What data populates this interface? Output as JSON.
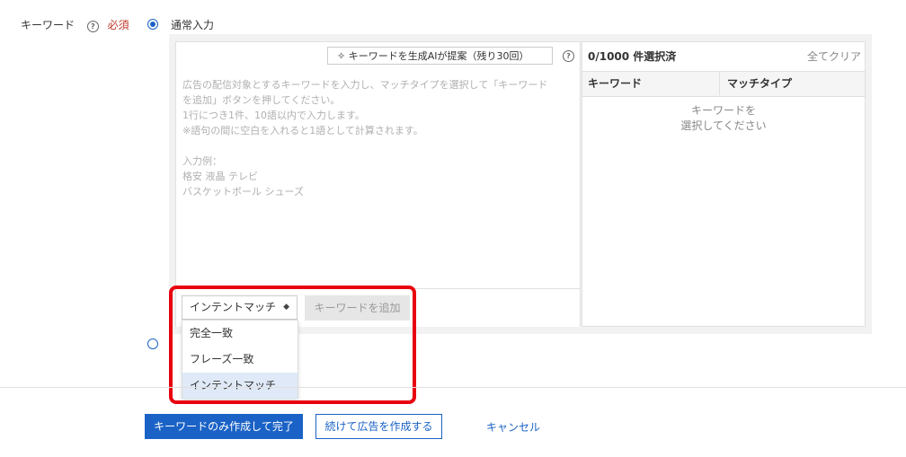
{
  "field": {
    "label": "キーワード",
    "help_glyph": "?",
    "required": "必須"
  },
  "mode": {
    "normal_label": "通常入力",
    "selected": "normal"
  },
  "input_panel": {
    "ai_button_label": "✧ キーワードを生成AIが提案（残り30回）",
    "help_glyph": "?",
    "placeholder": "広告の配信対象とするキーワードを入力し、マッチタイプを選択して「キーワード\nを追加」ボタンを押してください。\n1行につき1件、10語以内で入力します。\n※語句の間に空白を入れると1語として計算されます。\n\n入力例：\n格安 液晶 テレビ\nバスケットボール シューズ",
    "match_type_selected": "インテントマッチ",
    "select_arrow": "◆",
    "add_button_label": "キーワードを追加",
    "dropdown_options": [
      "完全一致",
      "フレーズ一致",
      "インテントマッチ"
    ],
    "dropdown_selected_index": 2
  },
  "selected_panel": {
    "count_text": "0/1000 件選択済",
    "clear_all_label": "全てクリア",
    "columns": [
      "キーワード",
      "マッチタイプ"
    ],
    "empty_message": "キーワードを\n選択してください"
  },
  "footer": {
    "create_keywords_only_label": "キーワードのみ作成して完了",
    "continue_create_ad_label": "続けて広告を作成する",
    "cancel_label": "キャンセル"
  },
  "colors": {
    "accent": "#1a62c6",
    "highlight_border": "#e8000f",
    "required": "#c0392b"
  }
}
